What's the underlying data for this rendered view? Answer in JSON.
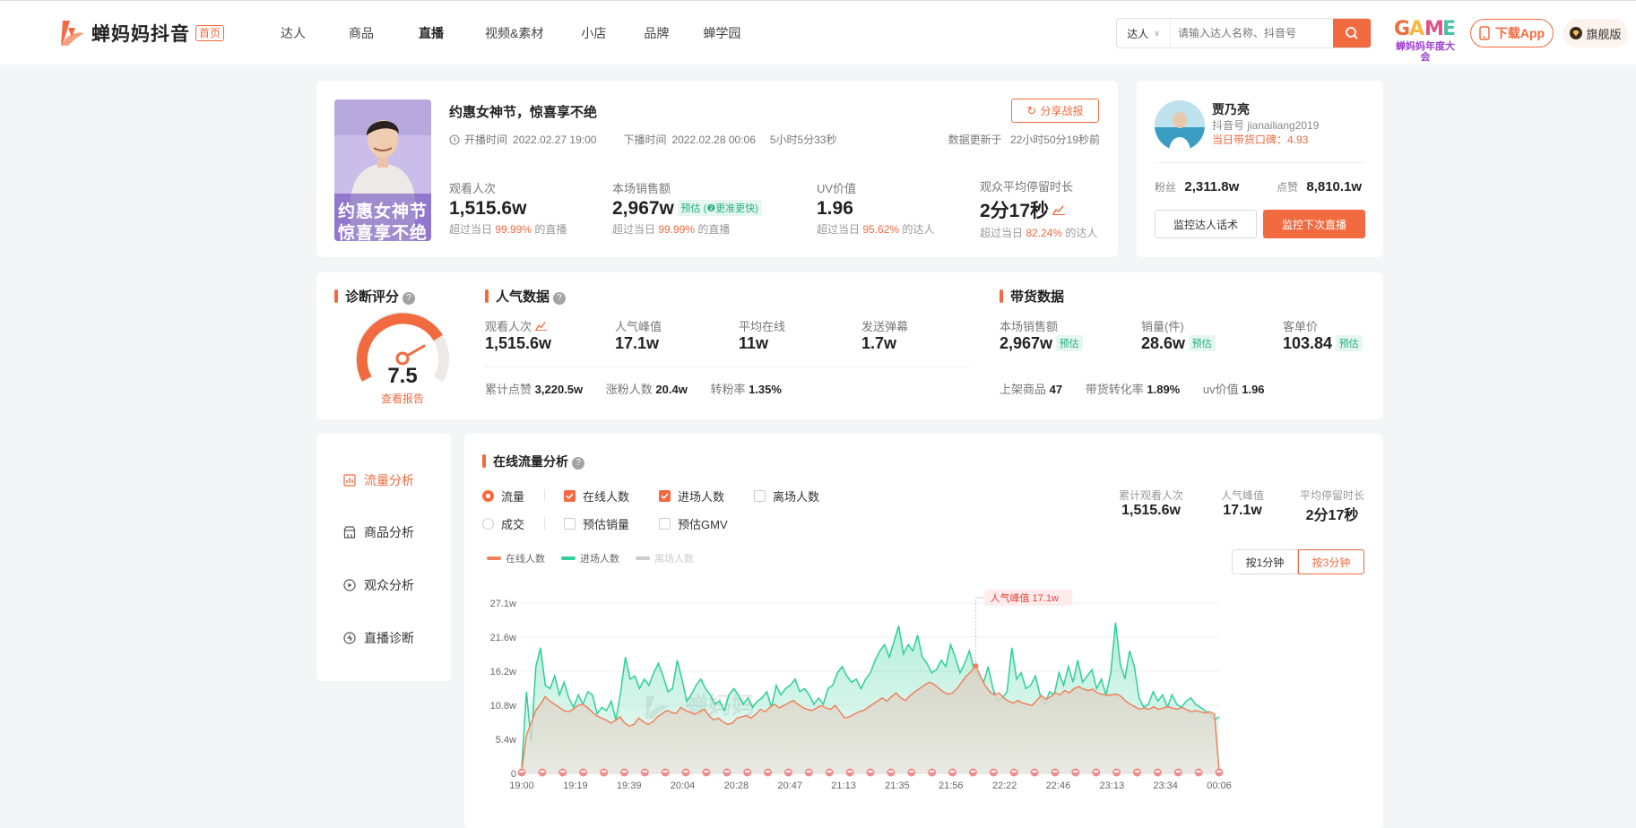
{
  "header": {
    "logo_text": "蝉妈妈抖音",
    "logo_badge": "首页",
    "nav": [
      "达人",
      "商品",
      "直播",
      "视频&素材",
      "小店",
      "品牌",
      "蝉学园"
    ],
    "search_type": "达人",
    "search_placeholder": "请输入达人名称、抖音号",
    "game_logo_text": "蝉妈妈年度大会",
    "download_label": "下载App",
    "flagship_label": "旗舰版"
  },
  "live": {
    "cover_caption_1": "约惠女神节",
    "cover_caption_2": "惊喜享不绝",
    "title": "约惠女神节，惊喜享不绝",
    "share_label": "分享战报",
    "start_label": "开播时间",
    "start_time": "2022.02.27 19:00",
    "end_label": "下播时间",
    "end_time": "2022.02.28 00:06",
    "duration": "5小时5分33秒",
    "update_label": "数据更新于",
    "update_value": "22小时50分19秒前",
    "metrics": [
      {
        "label": "观看人次",
        "value": "1,515.6w",
        "tag": "",
        "pre": "超过当日",
        "pct": "99.99%",
        "post": "的直播"
      },
      {
        "label": "本场销售额",
        "value": "2,967w",
        "tag": "预估 (❷更准更快)",
        "pre": "超过当日",
        "pct": "99.99%",
        "post": "的直播"
      },
      {
        "label": "UV价值",
        "value": "1.96",
        "tag": "",
        "pre": "超过当日",
        "pct": "95.62%",
        "post": "的达人"
      },
      {
        "label": "观众平均停留时长",
        "value": "2分17秒",
        "tag": "",
        "pre": "超过当日",
        "pct": "82.24%",
        "post": "的达人"
      }
    ]
  },
  "influencer": {
    "name": "贾乃亮",
    "account": "抖音号 jianailiang2019",
    "reputation": "当日带货口碑：4.93",
    "fans_label": "粉丝",
    "fans": "2,311.8w",
    "likes_label": "点赞",
    "likes": "8,810.1w",
    "monitor_script": "监控达人话术",
    "monitor_next": "监控下次直播"
  },
  "diagnosis": {
    "title": "诊断评分",
    "score": "7.5",
    "score_fraction": 0.75,
    "report_link": "查看报告"
  },
  "popularity": {
    "title": "人气数据",
    "stats": [
      {
        "label": "观看人次",
        "value": "1,515.6w"
      },
      {
        "label": "人气峰值",
        "value": "17.1w"
      },
      {
        "label": "平均在线",
        "value": "11w"
      },
      {
        "label": "发送弹幕",
        "value": "1.7w"
      }
    ],
    "sub": [
      {
        "label": "累计点赞",
        "value": "3,220.5w"
      },
      {
        "label": "涨粉人数",
        "value": "20.4w"
      },
      {
        "label": "转粉率",
        "value": "1.35%"
      }
    ]
  },
  "sales": {
    "title": "带货数据",
    "stats": [
      {
        "label": "本场销售额",
        "value": "2,967w",
        "tag": "预估"
      },
      {
        "label": "销量(件)",
        "value": "28.6w",
        "tag": "预估"
      },
      {
        "label": "客单价",
        "value": "103.84",
        "tag": "预估"
      }
    ],
    "sub": [
      {
        "label": "上架商品",
        "value": "47"
      },
      {
        "label": "带货转化率",
        "value": "1.89%"
      },
      {
        "label": "uv价值",
        "value": "1.96"
      }
    ]
  },
  "sidebar": {
    "items": [
      "流量分析",
      "商品分析",
      "观众分析",
      "直播诊断"
    ]
  },
  "traffic": {
    "title": "在线流量分析",
    "radio_flow": "流量",
    "radio_deal": "成交",
    "cb_online": "在线人数",
    "cb_enter": "进场人数",
    "cb_leave": "离场人数",
    "cb_sales": "预估销量",
    "cb_gmv": "预估GMV",
    "summary": [
      {
        "label": "累计观看人次",
        "value": "1,515.6w"
      },
      {
        "label": "人气峰值",
        "value": "17.1w"
      },
      {
        "label": "平均停留时长",
        "value": "2分17秒"
      }
    ],
    "btn_1min": "按1分钟",
    "btn_3min": "按3分钟",
    "peak_label": "人气峰值 17.1w",
    "watermark": "蝉妈妈"
  },
  "chart_data": {
    "type": "area",
    "legend": [
      "在线人数",
      "进场人数",
      "离场人数"
    ],
    "colors": {
      "online": "#f0825c",
      "enter": "#2ecf99",
      "leave": "#cccccc"
    },
    "y_ticks": [
      "0",
      "5.4w",
      "10.8w",
      "16.2w",
      "21.6w",
      "27.1w"
    ],
    "ylim": [
      0,
      27.1
    ],
    "x_ticks": [
      "19:00",
      "19:19",
      "19:39",
      "20:04",
      "20:28",
      "20:47",
      "21:13",
      "21:35",
      "21:56",
      "22:22",
      "22:46",
      "23:13",
      "23:34",
      "00:06"
    ],
    "series": [
      {
        "name": "在线人数",
        "values": [
          0.5,
          6,
          8,
          10,
          11,
          12.2,
          11.5,
          11,
          10.5,
          10,
          9.8,
          10.2,
          10.8,
          11,
          10.5,
          9.8,
          9.2,
          8.8,
          8.5,
          8,
          8.4,
          9,
          8,
          7.5,
          7.8,
          8.8,
          8.2,
          7.8,
          8.2,
          9,
          9.5,
          10,
          9.7,
          9.5,
          10.5,
          10,
          9.7,
          9.4,
          9.8,
          10.2,
          9.2,
          8.5,
          8.8,
          8.2,
          7.8,
          8,
          8.8,
          9,
          9.2,
          8.8,
          9.4,
          10.2,
          9.8,
          10.5,
          11,
          10.4,
          10.8,
          11.2,
          11.6,
          11,
          10.5,
          10.2,
          10,
          10.4,
          10.8,
          10.4,
          10.2,
          10.8,
          9.8,
          8.8,
          9,
          9.4,
          9.8,
          10,
          10.5,
          11,
          11.5,
          12,
          11.5,
          12.2,
          12.8,
          12,
          11.6,
          12.4,
          13,
          13.5,
          14,
          14.5,
          14.2,
          13.6,
          13,
          12.6,
          12.8,
          13.5,
          14.5,
          15.5,
          16.2,
          17.1,
          15.5,
          14,
          13,
          12.5,
          12.8,
          12,
          11.5,
          11.2,
          11.6,
          11.2,
          11,
          10.8,
          11.6,
          12.4,
          11.8,
          12.2,
          12.8,
          12.5,
          13.2,
          12.8,
          13.5,
          13.8,
          13.4,
          13.2,
          13.4,
          12.8,
          12.6,
          12.4,
          12.5,
          12.6,
          12.3,
          11.5,
          11,
          10.6,
          10.2,
          10.4,
          10.2,
          10.6,
          10.2,
          10.4,
          10.6,
          10.4,
          10.2,
          10.5,
          10.2,
          9.8,
          10,
          9.8,
          9.6,
          9.8,
          9.4,
          0.3
        ]
      },
      {
        "name": "进场人数",
        "values": [
          1,
          13,
          5,
          17,
          20,
          14,
          13.5,
          15.5,
          12.5,
          14.5,
          12,
          10.5,
          12.5,
          11,
          13,
          12.5,
          9.5,
          10.5,
          10,
          11.5,
          8.5,
          13,
          18.5,
          15,
          15.5,
          13.5,
          15,
          14,
          16,
          17.5,
          15.5,
          13,
          13.5,
          18,
          15,
          11.5,
          12.5,
          14,
          15,
          13.5,
          12.5,
          11,
          11.5,
          10,
          12.5,
          13.5,
          12.5,
          11,
          12,
          10.5,
          11.5,
          12,
          13,
          10.5,
          14,
          12.5,
          13.5,
          14,
          15,
          13,
          13.5,
          12.5,
          11,
          12,
          11,
          13.5,
          14,
          16,
          17,
          15.5,
          14.5,
          15,
          13.5,
          15,
          16,
          18,
          19.5,
          20.5,
          18.5,
          21,
          23.5,
          19,
          20.5,
          19.5,
          22,
          18.5,
          17.5,
          16,
          16.5,
          18,
          17,
          20.5,
          18.5,
          16,
          17.5,
          19.5,
          16.5,
          15.5,
          14.5,
          17,
          13.5,
          11.5,
          12,
          13,
          20,
          15,
          16,
          13.5,
          14,
          15.5,
          12.5,
          11,
          13,
          12.5,
          16,
          14,
          17,
          14.5,
          18,
          14.5,
          15.5,
          16.5,
          13.5,
          15,
          12.5,
          16,
          24,
          17.5,
          15,
          19.5,
          17,
          12,
          10.5,
          11,
          13,
          11.5,
          12.5,
          10.5,
          12.5,
          11,
          10.5,
          11.5,
          12,
          11,
          10.5,
          10,
          9.5,
          8.5,
          9
        ]
      }
    ]
  }
}
